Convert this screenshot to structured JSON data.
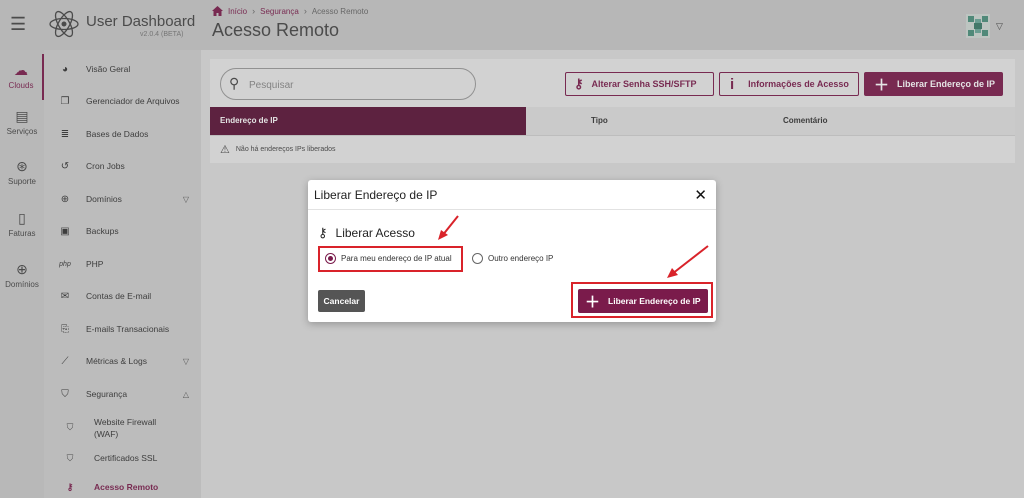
{
  "app": {
    "title": "User Dashboard",
    "version": "v2.0.4 (BETA)"
  },
  "breadcrumb": {
    "home": "Início",
    "section": "Segurança",
    "current": "Acesso Remoto"
  },
  "page": {
    "title": "Acesso Remoto"
  },
  "rail": [
    {
      "label": "Clouds",
      "icon": "cloud-icon"
    },
    {
      "label": "Serviços",
      "icon": "list-icon"
    },
    {
      "label": "Suporte",
      "icon": "lifebuoy-icon"
    },
    {
      "label": "Faturas",
      "icon": "invoice-icon"
    },
    {
      "label": "Domínios",
      "icon": "globe-icon"
    }
  ],
  "nav": {
    "items": [
      "Visão Geral",
      "Gerenciador de Arquivos",
      "Bases de Dados",
      "Cron Jobs",
      "Domínios",
      "Backups",
      "PHP",
      "Contas de E-mail",
      "E-mails Transacionais",
      "Métricas & Logs",
      "Segurança"
    ],
    "sub": [
      "Website Firewall (WAF)",
      "Certificados SSL",
      "Acesso Remoto"
    ]
  },
  "toolbar": {
    "search_placeholder": "Pesquisar",
    "ssh_button": "Alterar Senha SSH/SFTP",
    "info_button": "Informações de Acesso",
    "release_button": "Liberar Endereço de IP"
  },
  "table": {
    "columns": [
      "Endereço de IP",
      "Tipo",
      "Comentário"
    ],
    "empty": "Não há endereços IPs liberados"
  },
  "modal": {
    "title": "Liberar Endereço de IP",
    "section": "Liberar Acesso",
    "option_current": "Para meu endereço de IP atual",
    "option_other": "Outro endereço IP",
    "cancel": "Cancelar",
    "confirm": "Liberar Endereço de IP",
    "close": "✕"
  },
  "colors": {
    "accent": "#7a1b4b",
    "highlight": "#d9232a"
  }
}
